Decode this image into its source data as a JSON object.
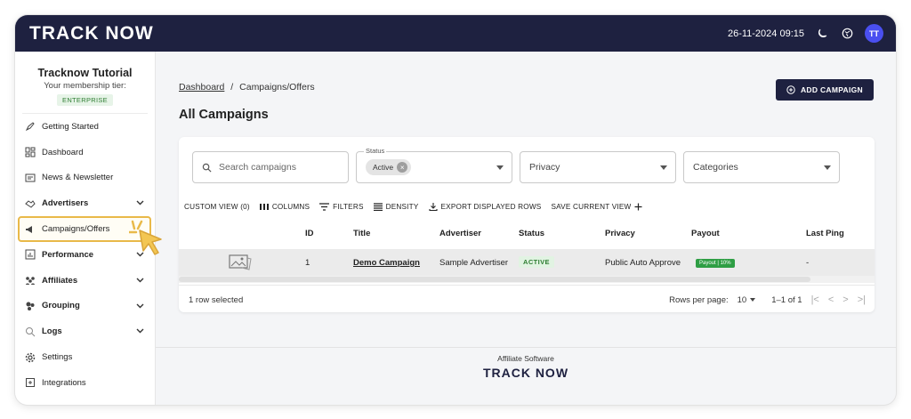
{
  "topbar": {
    "logo": "TRACK NOW",
    "datetime": "26-11-2024 09:15",
    "avatar_initials": "TT",
    "colors": {
      "bg": "#1e2140",
      "avatar": "#4a4ff0"
    }
  },
  "sidebar": {
    "title": "Tracknow Tutorial",
    "tier_label": "Your membership tier:",
    "tier": "ENTERPRISE",
    "items": [
      {
        "label": "Getting Started",
        "icon": "rocket-icon"
      },
      {
        "label": "Dashboard",
        "icon": "dashboard-icon"
      },
      {
        "label": "News & Newsletter",
        "icon": "news-icon"
      },
      {
        "label": "Advertisers",
        "icon": "handshake-icon",
        "expandable": true
      },
      {
        "label": "Campaigns/Offers",
        "icon": "megaphone-icon",
        "active": true
      },
      {
        "label": "Performance",
        "icon": "chart-icon",
        "expandable": true
      },
      {
        "label": "Affiliates",
        "icon": "people-icon",
        "expandable": true
      },
      {
        "label": "Grouping",
        "icon": "group-icon",
        "expandable": true
      },
      {
        "label": "Logs",
        "icon": "search-icon",
        "expandable": true
      },
      {
        "label": "Settings",
        "icon": "gear-icon"
      },
      {
        "label": "Integrations",
        "icon": "integration-icon"
      }
    ]
  },
  "main": {
    "breadcrumb": {
      "link": "Dashboard",
      "separator": "/",
      "current": "Campaigns/Offers"
    },
    "title": "All Campaigns",
    "add_button": "ADD CAMPAIGN",
    "search_placeholder": "Search campaigns",
    "status_legend": "Status",
    "status_chip": "Active",
    "privacy_label": "Privacy",
    "categories_label": "Categories",
    "toolbar": {
      "custom_view": "CUSTOM VIEW (0)",
      "columns": "COLUMNS",
      "filters": "FILTERS",
      "density": "DENSITY",
      "export": "EXPORT DISPLAYED ROWS",
      "save_view": "SAVE CURRENT VIEW"
    },
    "columns": [
      "ID",
      "Title",
      "Advertiser",
      "Status",
      "Privacy",
      "Payout",
      "Last Ping"
    ],
    "rows": [
      {
        "id": "1",
        "title": "Demo Campaign",
        "advertiser": "Sample Advertiser",
        "status": "ACTIVE",
        "privacy": "Public Auto Approve",
        "payout": "Payout | 10%",
        "last_ping": "-"
      }
    ],
    "footer": {
      "selected": "1 row selected",
      "rows_per_page_label": "Rows per page:",
      "rows_per_page": "10",
      "range": "1–1 of 1"
    }
  },
  "app_footer": {
    "text": "Affiliate Software",
    "logo": "TRACK NOW"
  }
}
